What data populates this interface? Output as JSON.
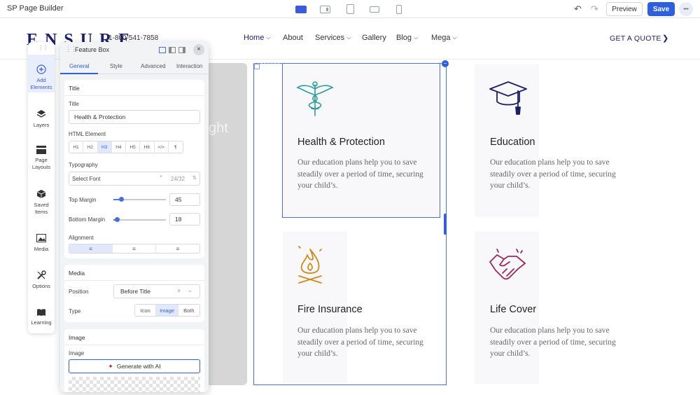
{
  "app": {
    "title": "SP Page Builder",
    "preview_label": "Preview",
    "save_label": "Save",
    "more_label": "•••"
  },
  "site": {
    "logo": "ENSURE",
    "phone": "1-800-541-7858",
    "nav": [
      {
        "label": "Home",
        "has_dropdown": true
      },
      {
        "label": "About",
        "has_dropdown": false
      },
      {
        "label": "Services",
        "has_dropdown": true
      },
      {
        "label": "Gallery",
        "has_dropdown": false
      },
      {
        "label": "Blog",
        "has_dropdown": true
      },
      {
        "label": "Mega",
        "has_dropdown": true
      }
    ],
    "cta": "GET A QUOTE",
    "hero_fragment": "ght"
  },
  "cards": [
    {
      "title": "Health & Protection",
      "desc": "Our education plans help you to save steadily over a period of time, securing your child’s.",
      "icon": "caduceus-icon",
      "color": "#2a9d9b"
    },
    {
      "title": "Education",
      "desc": "Our education plans help you to save steadily over a period of time, securing your child’s.",
      "icon": "graduation-cap-icon",
      "color": "#1b1f6b"
    },
    {
      "title": "Fire Insurance",
      "desc": "Our education plans help you to save steadily over a period of time, securing your child’s.",
      "icon": "campfire-icon",
      "color": "#d28a1d"
    },
    {
      "title": "Life Cover",
      "desc": "Our education plans help you to save steadily over a period of time, securing your child’s.",
      "icon": "handshake-icon",
      "color": "#a3265a"
    }
  ],
  "sidebar": {
    "items": [
      {
        "label": "Add Elements",
        "icon": "plus-circle-icon"
      },
      {
        "label": "Layers",
        "icon": "layers-icon"
      },
      {
        "label": "Page Layouts",
        "icon": "layout-icon"
      },
      {
        "label": "Saved Items",
        "icon": "box-icon"
      },
      {
        "label": "Media",
        "icon": "image-icon"
      },
      {
        "label": "Options",
        "icon": "tools-icon"
      },
      {
        "label": "Learning",
        "icon": "book-icon"
      }
    ]
  },
  "panel": {
    "title": "Feature Box",
    "tabs": [
      "General",
      "Style",
      "Advanced",
      "Interaction"
    ],
    "active_tab": "General",
    "title_section": {
      "header": "Title",
      "title_label": "Title",
      "title_value": "Health & Protection",
      "html_label": "HTML Element",
      "html_options": [
        "H1",
        "H2",
        "H3",
        "H4",
        "H5",
        "H6",
        "</>",
        "¶"
      ],
      "html_selected": "H3",
      "typography_label": "Typography",
      "font_placeholder": "Select Font",
      "font_size": "24/32",
      "top_margin_label": "Top Margin",
      "top_margin_value": "45",
      "bottom_margin_label": "Bottom Margin",
      "bottom_margin_value": "18",
      "alignment_label": "Alignment",
      "alignment_selected": "left"
    },
    "media_section": {
      "header": "Media",
      "position_label": "Position",
      "position_value": "Before Title",
      "type_label": "Type",
      "type_options": [
        "Icon",
        "Image",
        "Both"
      ],
      "type_selected": "Image"
    },
    "image_section": {
      "header": "Image",
      "image_label": "Image",
      "generate_label": "Generate with AI"
    }
  },
  "colors": {
    "accent": "#2d5fe0",
    "navy": "#1b1f6b"
  }
}
